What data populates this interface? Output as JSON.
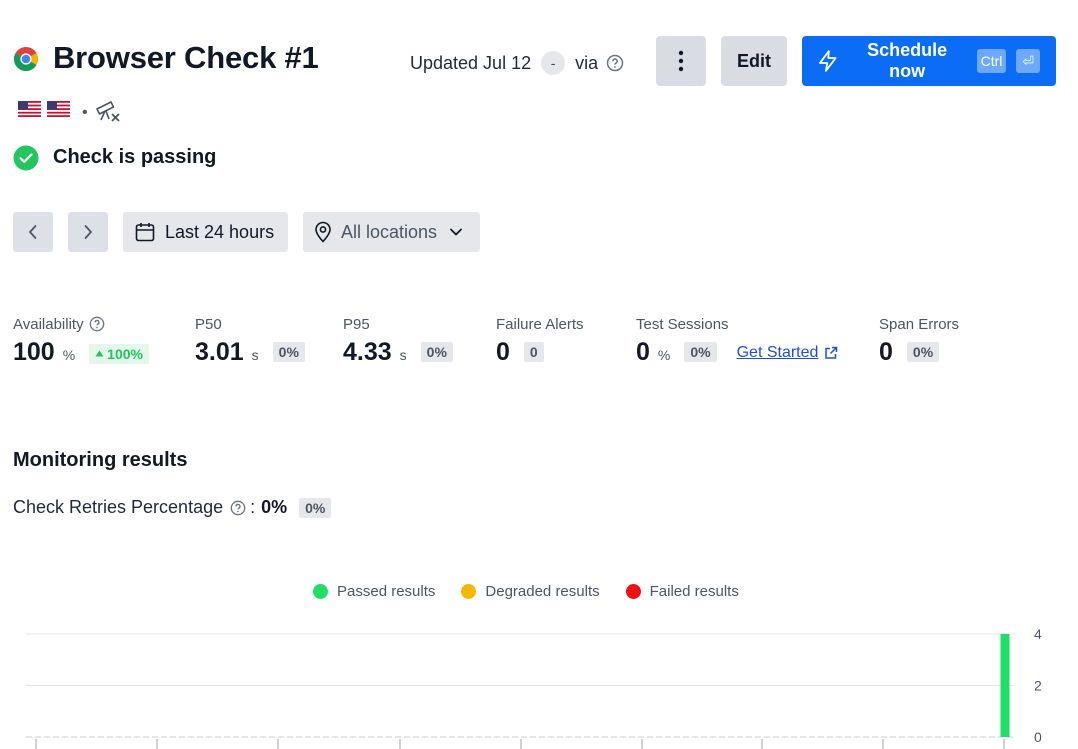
{
  "header": {
    "title": "Browser Check #1",
    "updated_label": "Updated Jul 12",
    "dash": "-",
    "via": "via",
    "edit_label": "Edit",
    "schedule_label": "Schedule now",
    "kbd_ctrl": "Ctrl",
    "kbd_enter": "⏎",
    "dot": "•"
  },
  "status": {
    "text": "Check is passing",
    "color": "#22c55e"
  },
  "toolbar": {
    "range_label": "Last 24 hours",
    "location_label": "All locations"
  },
  "stats": {
    "availability": {
      "label": "Availability",
      "value": "100",
      "unit": "%",
      "badge": "100%"
    },
    "p50": {
      "label": "P50",
      "value": "3.01",
      "unit": "s",
      "badge": "0%"
    },
    "p95": {
      "label": "P95",
      "value": "4.33",
      "unit": "s",
      "badge": "0%"
    },
    "failure_alerts": {
      "label": "Failure Alerts",
      "value": "0",
      "badge": "0"
    },
    "test_sessions": {
      "label": "Test Sessions",
      "value": "0",
      "unit": "%",
      "badge": "0%",
      "link": "Get Started"
    },
    "span_errors": {
      "label": "Span Errors",
      "value": "0",
      "badge": "0%"
    }
  },
  "monitoring": {
    "title": "Monitoring results",
    "retries_label": "Check Retries Percentage",
    "retries_colon": ":",
    "retries_value": "0%",
    "retries_badge": "0%"
  },
  "chart_data": {
    "type": "bar",
    "series": [
      {
        "name": "Passed results",
        "color": "#22dd66",
        "values": [
          0,
          0,
          0,
          0,
          0,
          0,
          0,
          0,
          4
        ]
      },
      {
        "name": "Degraded results",
        "color": "#f5b800",
        "values": [
          0,
          0,
          0,
          0,
          0,
          0,
          0,
          0,
          0
        ]
      },
      {
        "name": "Failed results",
        "color": "#ee1111",
        "values": [
          0,
          0,
          0,
          0,
          0,
          0,
          0,
          0,
          0
        ]
      }
    ],
    "y_ticks": [
      "4",
      "2",
      "0"
    ],
    "ylim": [
      0,
      4
    ],
    "grid": true,
    "legend": "top-center"
  }
}
